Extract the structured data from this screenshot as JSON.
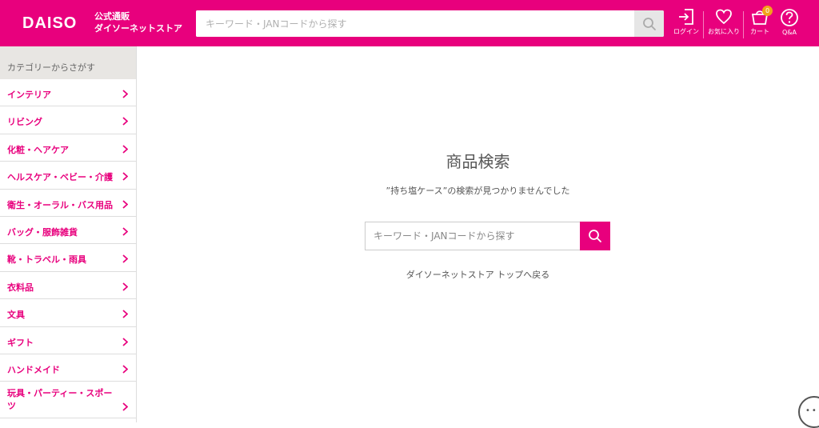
{
  "header": {
    "logo": "DAISO",
    "logo_sub_line1": "公式通販",
    "logo_sub_line2": "ダイソーネットストア",
    "search_placeholder": "キーワード・JANコードから探す",
    "login_label": "ログイン",
    "favorites_label": "お気に入り",
    "cart_label": "カート",
    "cart_count": "0",
    "qa_label": "Q&A",
    "brand_color": "#e8007d"
  },
  "sidebar": {
    "title": "カテゴリーからさがす",
    "items": [
      {
        "label": "インテリア"
      },
      {
        "label": "リビング"
      },
      {
        "label": "化粧・ヘアケア"
      },
      {
        "label": "ヘルスケア・ベビー・介護"
      },
      {
        "label": "衛生・オーラル・バス用品"
      },
      {
        "label": "バッグ・服飾雑貨"
      },
      {
        "label": "靴・トラベル・雨具"
      },
      {
        "label": "衣料品"
      },
      {
        "label": "文具"
      },
      {
        "label": "ギフト"
      },
      {
        "label": "ハンドメイド"
      },
      {
        "label": "玩具・パーティー・スポーツ"
      }
    ]
  },
  "main": {
    "title": "商品検索",
    "message": "”持ち塩ケース”の検索が見つかりませんでした",
    "search_placeholder": "キーワード・JANコードから探す",
    "back_link": "ダイソーネットストア トップへ戻る"
  },
  "icons": {
    "search": "search-icon",
    "login": "login-icon",
    "favorites": "heart-icon",
    "cart": "cart-icon",
    "help": "help-icon",
    "chevron": "chevron-right-icon",
    "chat": "chat-icon"
  }
}
